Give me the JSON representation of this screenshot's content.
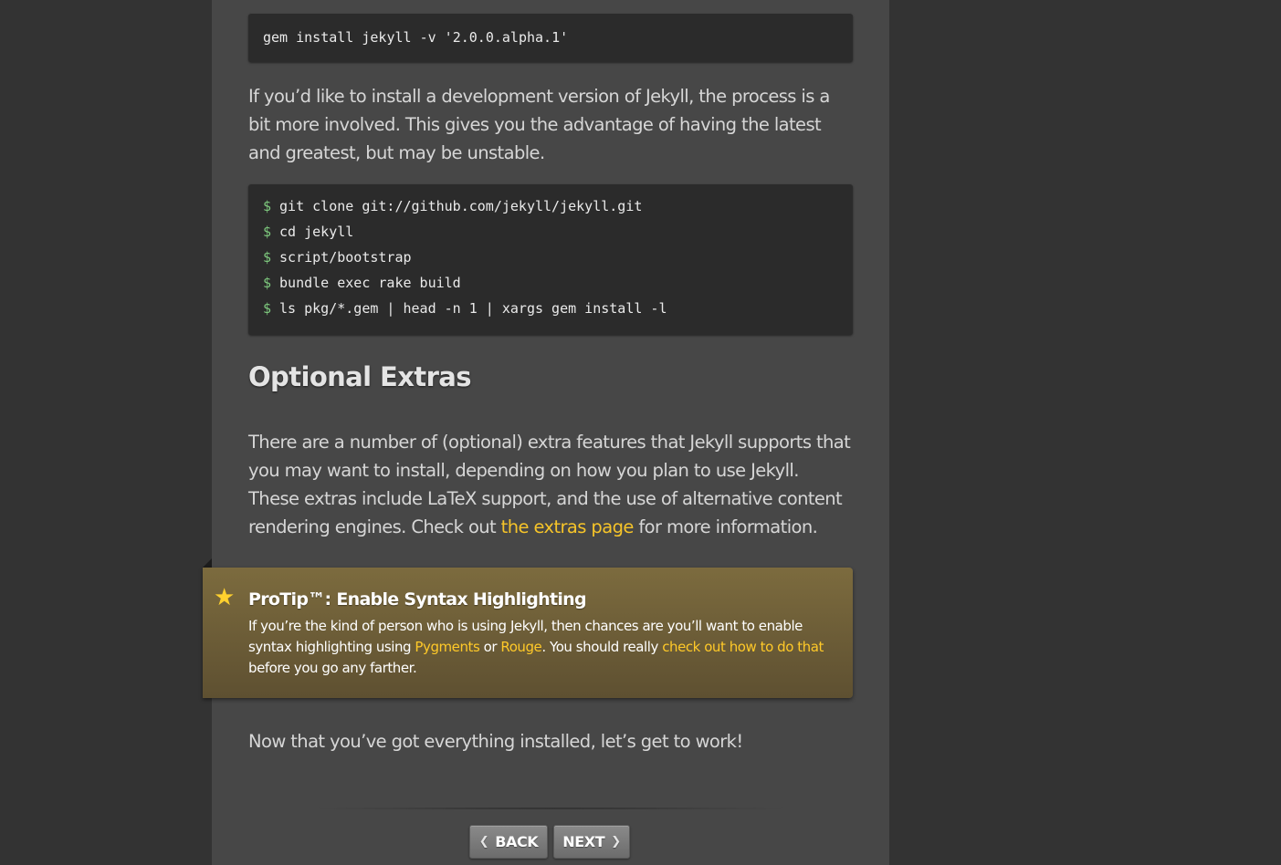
{
  "install_block": {
    "code": "gem install jekyll -v '2.0.0.alpha.1'"
  },
  "dev_intro": {
    "text": "If you’d like to install a development version of Jekyll, the process is a bit more involved. This gives you the advantage of having the latest and greatest, but may be unstable."
  },
  "dev_block": {
    "prompt": "$",
    "lines": [
      "git clone git://github.com/jekyll/jekyll.git",
      "cd jekyll",
      "script/bootstrap",
      "bundle exec rake build",
      "ls pkg/*.gem | head -n 1 | xargs gem install -l"
    ]
  },
  "extras": {
    "heading": "Optional Extras",
    "text_before": "There are a number of (optional) extra features that Jekyll supports that you may want to install, depending on how you plan to use Jekyll. These extras include LaTeX support, and the use of alternative content rendering engines. Check out ",
    "link": "the extras page",
    "text_after": " for more information."
  },
  "protip": {
    "star_icon": "star-icon",
    "title": "ProTip™: Enable Syntax Highlighting",
    "text_1": "If you’re the kind of person who is using Jekyll, then chances are you’ll want to enable syntax highlighting using ",
    "link_pygments": "Pygments",
    "text_2": " or ",
    "link_rouge": "Rouge",
    "text_3": ". You should really ",
    "link_howto": "check out how to do that",
    "text_4": " before you go any farther."
  },
  "closing": {
    "text": "Now that you’ve got everything installed, let’s get to work!"
  },
  "nav": {
    "back_label": "BACK",
    "next_label": "NEXT",
    "back_icon": "chevron-left-icon",
    "next_icon": "chevron-right-icon"
  },
  "colors": {
    "page_bg": "#333333",
    "content_bg": "#474747",
    "code_bg": "#2b2b2b",
    "link": "#f6c429",
    "note_bg": "#7c6b3e",
    "prompt": "#7ec97e"
  }
}
